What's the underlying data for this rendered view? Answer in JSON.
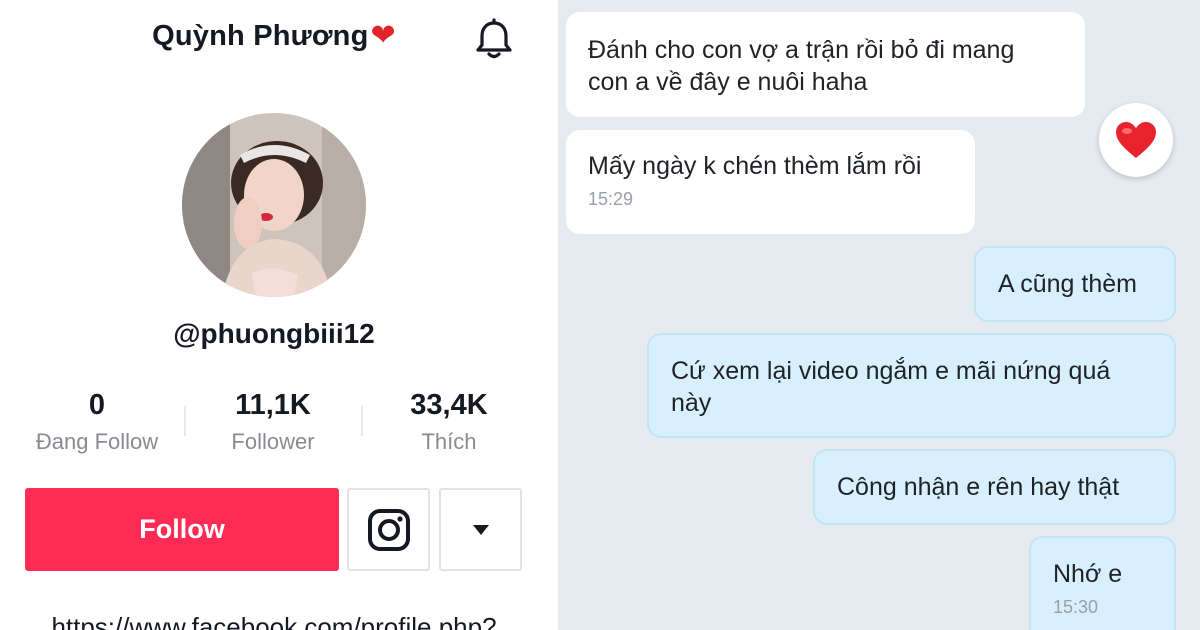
{
  "profile": {
    "display_name": "Quỳnh Phương",
    "name_emoji": "❤",
    "handle": "@phuongbiii12",
    "stats": [
      {
        "value": "0",
        "label": "Đang Follow"
      },
      {
        "value": "11,1K",
        "label": "Follower"
      },
      {
        "value": "33,4K",
        "label": "Thích"
      }
    ],
    "follow_label": "Follow",
    "bio_link": "https://www.facebook.com/profile.php?"
  },
  "chat": {
    "messages": [
      {
        "direction": "incoming",
        "text_lines": [
          "Đánh cho con vợ a trận rồi bỏ đi mang",
          "con a về đây e nuôi haha"
        ],
        "time": ""
      },
      {
        "direction": "incoming",
        "text_lines": [
          "Mấy ngày k chén thèm lắm rồi"
        ],
        "time": "15:29"
      },
      {
        "direction": "outgoing",
        "text_lines": [
          "A cũng thèm"
        ],
        "time": ""
      },
      {
        "direction": "outgoing",
        "text_lines": [
          "Cứ xem lại video ngắm e mãi nứng quá",
          "này"
        ],
        "time": ""
      },
      {
        "direction": "outgoing",
        "text_lines": [
          "Công nhận e rên hay thật"
        ],
        "time": ""
      },
      {
        "direction": "outgoing",
        "text_lines": [
          "Nhớ e"
        ],
        "time": "15:30"
      }
    ],
    "reaction": "heart"
  },
  "colors": {
    "follow_button": "#fe2c55",
    "incoming_bubble": "#ffffff",
    "outgoing_bubble": "#d8f0fd",
    "chat_background": "#e6ebf0"
  },
  "icons": [
    "bell-icon",
    "instagram-icon",
    "dropdown-caret-icon",
    "heart-reaction-icon"
  ]
}
